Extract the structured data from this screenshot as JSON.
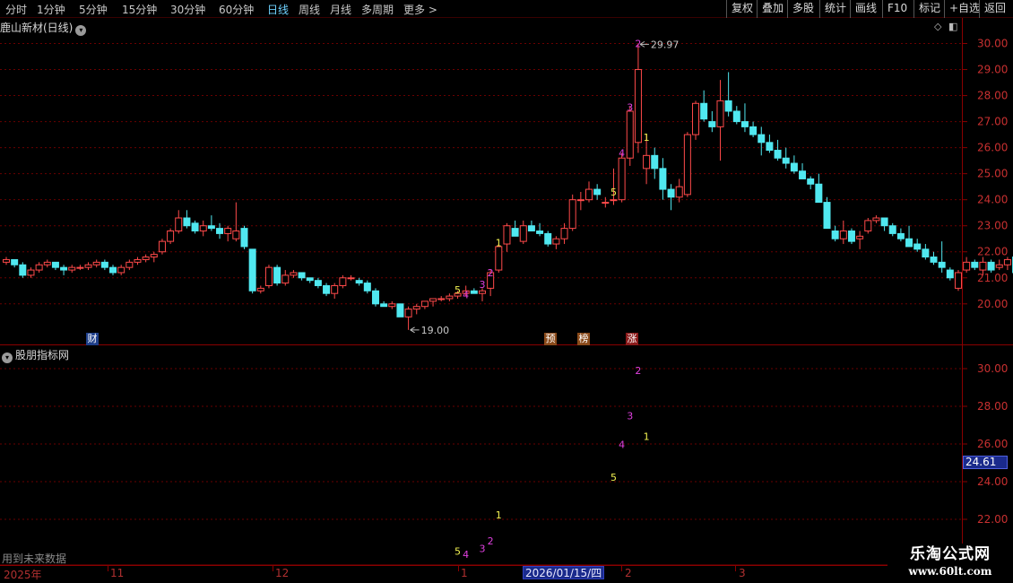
{
  "toolbar": {
    "periods": [
      "分时",
      "1分钟",
      "5分钟",
      "15分钟",
      "30分钟",
      "60分钟",
      "日线",
      "周线",
      "月线",
      "多周期",
      "更多 >"
    ],
    "active_period": "日线",
    "buttons": [
      "复权",
      "叠加",
      "多股",
      "统计",
      "画线",
      "F10",
      "标记",
      "+自选",
      "返回"
    ]
  },
  "main_title": "鹿山新材(日线)",
  "indicator_title": "股朋指标网",
  "future_note": "用到未来数据",
  "logo": {
    "name": "乐淘公式网",
    "url": "www.60lt.com"
  },
  "price_axis": {
    "min": 20,
    "max": 30,
    "step": 1,
    "labels": [
      "30.00",
      "29.00",
      "28.00",
      "27.00",
      "26.00",
      "25.00",
      "24.00",
      "23.00",
      "22.00",
      "21.00",
      "20.00"
    ]
  },
  "indicator_axis": {
    "labels": [
      "30.00",
      "28.00",
      "26.00",
      "24.00",
      "22.00"
    ],
    "cursor_value": "24.61"
  },
  "annotations": {
    "high_label": "29.97",
    "low_label": "19.00"
  },
  "event_badges": [
    {
      "text": "财",
      "color": "#1f3f8a"
    },
    {
      "text": "预",
      "color": "#8a4a1a"
    },
    {
      "text": "榜",
      "color": "#8a4a1a"
    },
    {
      "text": "涨",
      "color": "#8a1a1a"
    }
  ],
  "date_axis": {
    "labels": [
      "2025年",
      "11",
      "12",
      "1",
      "2",
      "3"
    ],
    "cursor_date": "2026/01/15/四"
  },
  "colors": {
    "up": "#ff4a4a",
    "down": "#50e8f0",
    "grid": "#6a0000",
    "magenta": "#e040e0",
    "yellow": "#f0f050"
  },
  "chart_data": {
    "type": "candlestick",
    "candles": [
      [
        21.6,
        21.8,
        21.5,
        21.7
      ],
      [
        21.7,
        21.7,
        21.4,
        21.5
      ],
      [
        21.5,
        21.6,
        21.0,
        21.1
      ],
      [
        21.1,
        21.4,
        21.0,
        21.3
      ],
      [
        21.3,
        21.6,
        21.2,
        21.5
      ],
      [
        21.5,
        21.7,
        21.4,
        21.6
      ],
      [
        21.6,
        21.6,
        21.3,
        21.4
      ],
      [
        21.4,
        21.5,
        21.1,
        21.3
      ],
      [
        21.3,
        21.5,
        21.2,
        21.4
      ],
      [
        21.4,
        21.5,
        21.3,
        21.4
      ],
      [
        21.4,
        21.6,
        21.3,
        21.5
      ],
      [
        21.5,
        21.7,
        21.4,
        21.6
      ],
      [
        21.6,
        21.7,
        21.3,
        21.4
      ],
      [
        21.4,
        21.5,
        21.1,
        21.2
      ],
      [
        21.2,
        21.5,
        21.1,
        21.4
      ],
      [
        21.4,
        21.7,
        21.3,
        21.6
      ],
      [
        21.6,
        21.8,
        21.5,
        21.7
      ],
      [
        21.7,
        21.9,
        21.6,
        21.8
      ],
      [
        21.8,
        22.0,
        21.6,
        21.9
      ],
      [
        22.0,
        22.5,
        21.9,
        22.4
      ],
      [
        22.4,
        22.9,
        22.3,
        22.8
      ],
      [
        22.8,
        23.6,
        22.7,
        23.3
      ],
      [
        23.3,
        23.6,
        22.9,
        23.0
      ],
      [
        23.1,
        23.2,
        22.7,
        22.8
      ],
      [
        22.8,
        23.2,
        22.6,
        23.0
      ],
      [
        23.0,
        23.4,
        22.8,
        22.9
      ],
      [
        22.9,
        23.1,
        22.5,
        22.7
      ],
      [
        22.7,
        23.0,
        22.4,
        22.9
      ],
      [
        22.5,
        23.9,
        22.4,
        22.8
      ],
      [
        22.9,
        23.0,
        22.1,
        22.2
      ],
      [
        22.1,
        22.1,
        20.4,
        20.5
      ],
      [
        20.5,
        20.7,
        20.4,
        20.6
      ],
      [
        20.7,
        21.5,
        20.6,
        21.4
      ],
      [
        21.4,
        21.5,
        20.7,
        20.8
      ],
      [
        20.8,
        21.3,
        20.7,
        21.1
      ],
      [
        21.1,
        21.3,
        21.0,
        21.2
      ],
      [
        21.2,
        21.2,
        20.9,
        21.0
      ],
      [
        21.0,
        21.0,
        20.8,
        20.9
      ],
      [
        20.9,
        21.0,
        20.6,
        20.7
      ],
      [
        20.7,
        20.8,
        20.3,
        20.4
      ],
      [
        20.4,
        20.8,
        20.2,
        20.7
      ],
      [
        20.7,
        21.1,
        20.6,
        21.0
      ],
      [
        21.0,
        21.1,
        20.9,
        21.0
      ],
      [
        20.9,
        21.0,
        20.7,
        20.8
      ],
      [
        20.8,
        20.9,
        20.4,
        20.5
      ],
      [
        20.5,
        20.6,
        19.9,
        20.0
      ],
      [
        20.0,
        20.1,
        19.9,
        19.9
      ],
      [
        19.9,
        20.1,
        19.8,
        20.0
      ],
      [
        20.0,
        20.0,
        19.5,
        19.5
      ],
      [
        19.5,
        19.9,
        19.0,
        19.8
      ],
      [
        19.8,
        20.0,
        19.6,
        19.9
      ],
      [
        19.9,
        20.1,
        19.8,
        20.1
      ],
      [
        20.1,
        20.2,
        19.9,
        20.2
      ],
      [
        20.2,
        20.3,
        20.1,
        20.2
      ],
      [
        20.2,
        20.4,
        20.1,
        20.3
      ],
      [
        20.3,
        20.5,
        20.2,
        20.4
      ],
      [
        20.4,
        20.7,
        20.3,
        20.5
      ],
      [
        20.5,
        20.6,
        20.4,
        20.4
      ],
      [
        20.4,
        20.6,
        20.1,
        20.5
      ],
      [
        20.6,
        21.3,
        20.3,
        21.2
      ],
      [
        21.3,
        22.3,
        21.2,
        22.2
      ],
      [
        22.3,
        23.1,
        22.0,
        23.0
      ],
      [
        22.9,
        23.2,
        22.6,
        22.6
      ],
      [
        22.4,
        23.2,
        22.3,
        23.0
      ],
      [
        23.0,
        23.2,
        22.8,
        22.8
      ],
      [
        22.8,
        23.1,
        22.6,
        22.7
      ],
      [
        22.7,
        22.8,
        22.2,
        22.3
      ],
      [
        22.3,
        22.6,
        22.1,
        22.5
      ],
      [
        22.5,
        23.1,
        22.3,
        22.9
      ],
      [
        22.9,
        24.2,
        22.8,
        24.0
      ],
      [
        24.0,
        24.3,
        23.6,
        24.0
      ],
      [
        24.0,
        24.7,
        23.9,
        24.4
      ],
      [
        24.4,
        24.6,
        24.0,
        24.2
      ],
      [
        23.9,
        24.1,
        23.7,
        23.9
      ],
      [
        24.0,
        25.2,
        23.8,
        24.0
      ],
      [
        24.0,
        25.8,
        23.9,
        25.6
      ],
      [
        25.6,
        27.6,
        25.3,
        27.4
      ],
      [
        26.2,
        29.97,
        25.8,
        29.0
      ],
      [
        25.2,
        26.5,
        24.6,
        25.7
      ],
      [
        25.7,
        26.0,
        24.8,
        25.2
      ],
      [
        25.2,
        25.6,
        24.0,
        24.4
      ],
      [
        24.4,
        24.6,
        23.6,
        24.1
      ],
      [
        24.1,
        24.8,
        23.9,
        24.5
      ],
      [
        24.2,
        26.6,
        24.1,
        26.5
      ],
      [
        26.5,
        27.8,
        26.3,
        27.7
      ],
      [
        27.7,
        28.2,
        27.0,
        27.1
      ],
      [
        27.0,
        27.4,
        26.6,
        26.8
      ],
      [
        26.8,
        28.6,
        25.5,
        27.8
      ],
      [
        27.8,
        28.9,
        27.2,
        27.4
      ],
      [
        27.4,
        27.6,
        26.9,
        27.0
      ],
      [
        27.0,
        27.7,
        26.6,
        26.8
      ],
      [
        26.8,
        27.0,
        26.4,
        26.5
      ],
      [
        26.5,
        26.8,
        25.7,
        26.2
      ],
      [
        26.2,
        26.5,
        25.8,
        25.9
      ],
      [
        25.9,
        26.3,
        25.5,
        25.6
      ],
      [
        25.6,
        26.0,
        25.2,
        25.4
      ],
      [
        25.4,
        25.7,
        25.0,
        25.1
      ],
      [
        25.1,
        25.4,
        24.9,
        24.8
      ],
      [
        24.8,
        24.9,
        24.4,
        24.6
      ],
      [
        24.6,
        25.0,
        24.0,
        23.9
      ],
      [
        23.9,
        24.1,
        22.9,
        22.9
      ],
      [
        22.8,
        23.0,
        22.4,
        22.5
      ],
      [
        22.5,
        23.2,
        22.3,
        22.8
      ],
      [
        22.8,
        22.9,
        22.3,
        22.4
      ],
      [
        22.5,
        22.8,
        22.1,
        22.6
      ],
      [
        22.8,
        23.3,
        22.7,
        23.2
      ],
      [
        23.2,
        23.4,
        23.1,
        23.3
      ],
      [
        23.3,
        23.3,
        22.8,
        23.0
      ],
      [
        23.0,
        23.1,
        22.6,
        22.7
      ],
      [
        22.7,
        22.9,
        22.4,
        22.5
      ],
      [
        22.5,
        23.0,
        22.3,
        22.2
      ],
      [
        22.3,
        22.5,
        22.0,
        22.1
      ],
      [
        22.1,
        22.3,
        21.7,
        21.8
      ],
      [
        21.8,
        22.0,
        21.5,
        21.6
      ],
      [
        21.6,
        22.4,
        21.2,
        21.4
      ],
      [
        21.3,
        21.4,
        20.9,
        21.0
      ],
      [
        20.6,
        21.3,
        20.5,
        21.2
      ],
      [
        21.3,
        21.8,
        21.2,
        21.6
      ],
      [
        21.6,
        21.7,
        21.3,
        21.4
      ],
      [
        21.3,
        21.8,
        21.1,
        21.6
      ],
      [
        21.6,
        21.7,
        21.2,
        21.3
      ],
      [
        21.4,
        21.7,
        21.3,
        21.5
      ],
      [
        21.5,
        21.8,
        21.3,
        21.7
      ],
      [
        21.8,
        21.9,
        21.1,
        21.2
      ],
      [
        21.2,
        21.4,
        20.9,
        21.1
      ],
      [
        21.0,
        21.1,
        20.4,
        20.5
      ]
    ],
    "main_markers": [
      {
        "index": 55,
        "text": "5",
        "color": "#f0f050",
        "price": 20.55
      },
      {
        "index": 56,
        "text": "4",
        "color": "#e040e0",
        "price": 20.35
      },
      {
        "index": 58,
        "text": "3",
        "color": "#e040e0",
        "price": 20.75
      },
      {
        "index": 59,
        "text": "2",
        "color": "#e040e0",
        "price": 21.2
      },
      {
        "index": 60,
        "text": "1",
        "color": "#f0f050",
        "price": 22.35
      },
      {
        "index": 74,
        "text": "5",
        "color": "#f0f050",
        "price": 24.3
      },
      {
        "index": 75,
        "text": "4",
        "color": "#e040e0",
        "price": 25.8
      },
      {
        "index": 76,
        "text": "3",
        "color": "#e040e0",
        "price": 27.55
      },
      {
        "index": 77,
        "text": "2",
        "color": "#e040e0",
        "price": 30.0
      },
      {
        "index": 78,
        "text": "1",
        "color": "#f0f050",
        "price": 26.4
      }
    ],
    "indicator_markers": [
      {
        "index": 55,
        "text": "5",
        "color": "#f0f050",
        "value": 20.3
      },
      {
        "index": 56,
        "text": "4",
        "color": "#e040e0",
        "value": 20.15
      },
      {
        "index": 58,
        "text": "3",
        "color": "#e040e0",
        "value": 20.45
      },
      {
        "index": 59,
        "text": "2",
        "color": "#e040e0",
        "value": 20.85
      },
      {
        "index": 60,
        "text": "1",
        "color": "#f0f050",
        "value": 22.25
      },
      {
        "index": 74,
        "text": "5",
        "color": "#f0f050",
        "value": 24.25
      },
      {
        "index": 75,
        "text": "4",
        "color": "#e040e0",
        "value": 25.98
      },
      {
        "index": 76,
        "text": "3",
        "color": "#e040e0",
        "value": 27.5
      },
      {
        "index": 77,
        "text": "2",
        "color": "#e040e0",
        "value": 29.9
      },
      {
        "index": 78,
        "text": "1",
        "color": "#f0f050",
        "value": 26.4
      }
    ]
  }
}
